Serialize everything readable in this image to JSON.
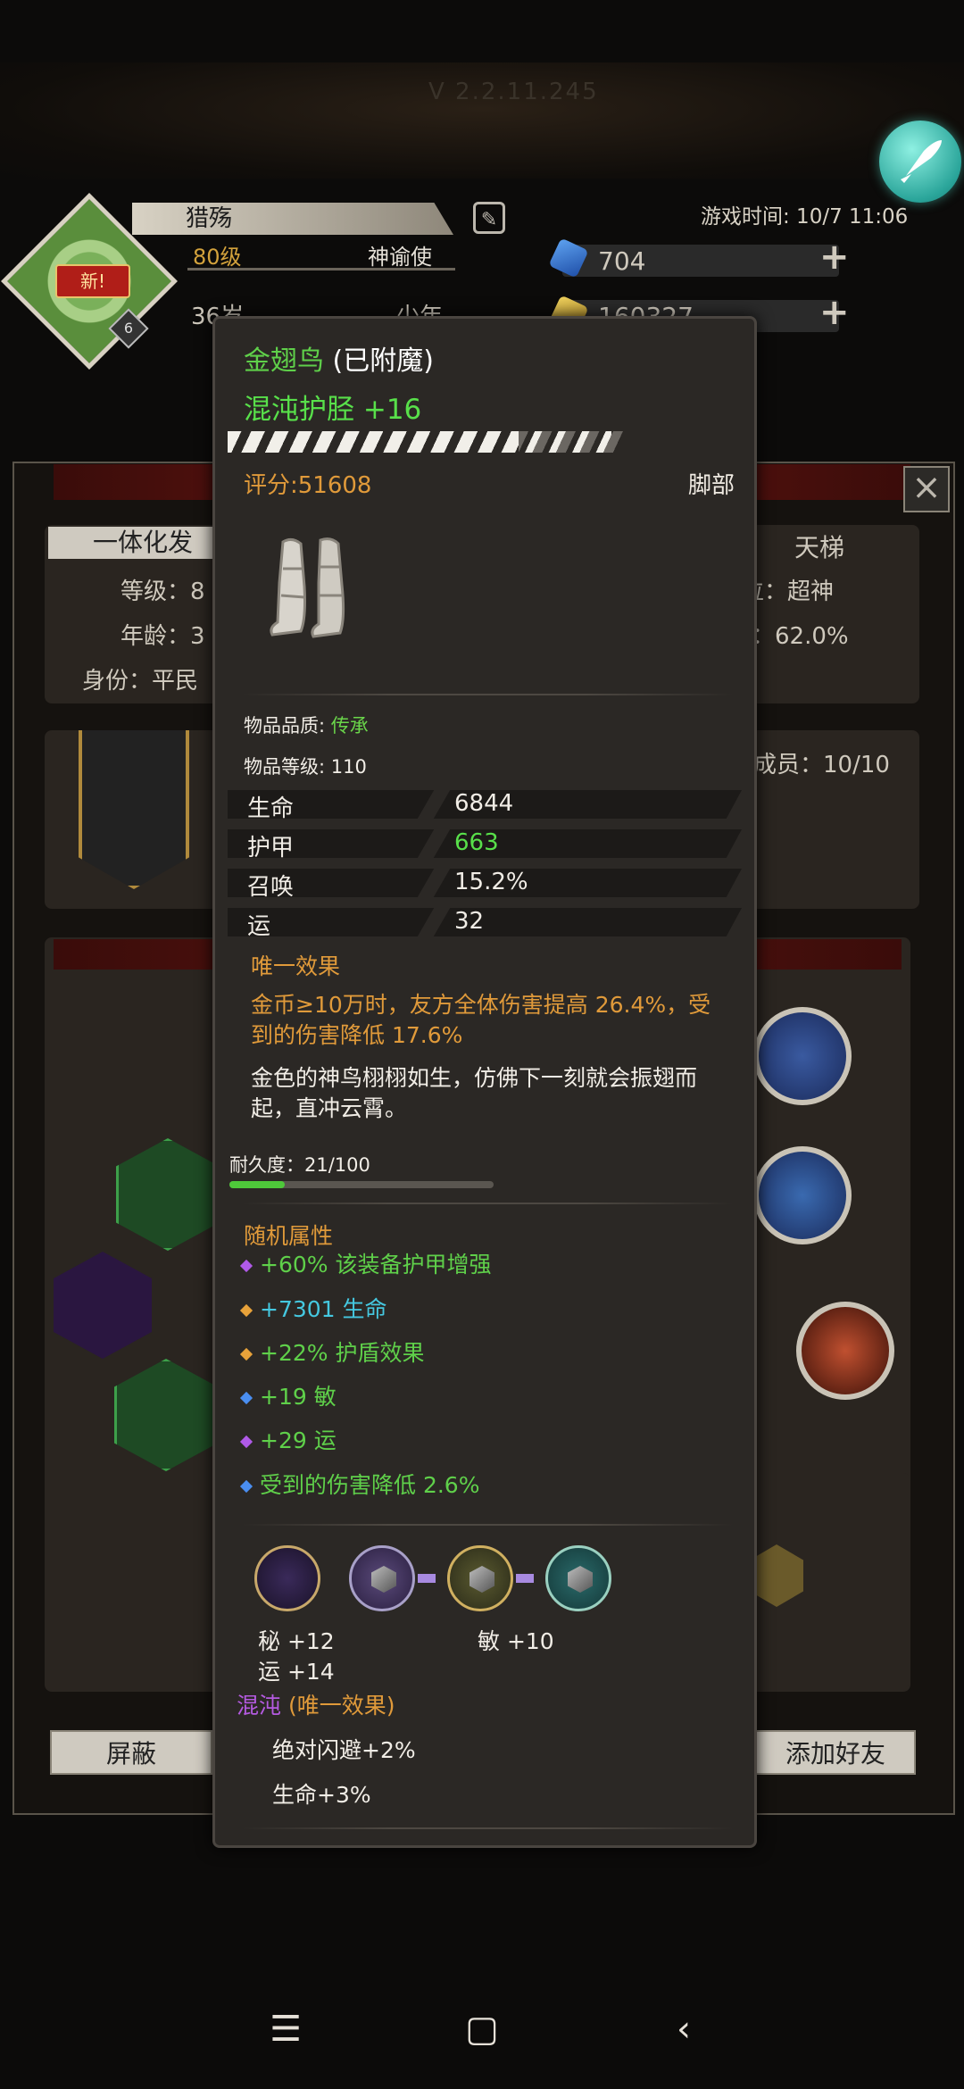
{
  "header": {
    "top_title": "V 2.2.11.245",
    "game_time": "游戏时间: 10/7 11:06",
    "new_badge": "新!",
    "avatar_level": "6",
    "player_name": "猎殇",
    "player_level": "80级",
    "player_role": "神谕使",
    "player_age": "36岁",
    "player_stage": "少年",
    "resources": [
      {
        "icon": "blue-crystal-icon",
        "value": "704"
      },
      {
        "icon": "gold-crystal-icon",
        "value": "160327"
      }
    ]
  },
  "background": {
    "tab_left": "一体化发",
    "tab_right": "天梯",
    "rows": [
      {
        "label": "等级：8",
        "right": "位：超神"
      },
      {
        "label": "年龄：3",
        "right": "：62.0%"
      },
      {
        "label": "身份：平民"
      }
    ],
    "members": "成员：10/10",
    "btn_block": "屏蔽",
    "btn_add_friend": "添加好友"
  },
  "tooltip": {
    "enchant_name": "金翅鸟",
    "enchant_suffix": "(已附魔)",
    "item_name": "混沌护胫 +16",
    "score": "评分:51608",
    "slot": "脚部",
    "quality_label": "物品品质: ",
    "quality_value": "传承",
    "item_level": "物品等级: 110",
    "stats": [
      {
        "name": "生命",
        "value": "6844",
        "highlight": false
      },
      {
        "name": "护甲",
        "value": "663",
        "highlight": true
      },
      {
        "name": "召唤",
        "value": "15.2%",
        "highlight": false
      },
      {
        "name": "运",
        "value": "32",
        "highlight": false
      }
    ],
    "unique_title": "唯一效果",
    "unique_text": "金币≥10万时，友方全体伤害提高 26.4%，受到的伤害降低 17.6%",
    "flavor_text": "金色的神鸟栩栩如生，仿佛下一刻就会振翅而起，直冲云霄。",
    "durability_label": "耐久度：21/100",
    "durability_current": 21,
    "durability_max": 100,
    "random_title": "随机属性",
    "random_attrs": [
      {
        "text": "+60% 该装备护甲增强",
        "dot": "#b05ae8",
        "color": "green"
      },
      {
        "text": "+7301 生命",
        "dot": "#e8a23a",
        "color": "blue"
      },
      {
        "text": "+22% 护盾效果",
        "dot": "#e8a23a",
        "color": "green"
      },
      {
        "text": "+19 敏",
        "dot": "#4a8ef0",
        "color": "green"
      },
      {
        "text": "+29 运",
        "dot": "#b05ae8",
        "color": "green"
      },
      {
        "text": "受到的伤害降低 2.6%",
        "dot": "#4a8ef0",
        "color": "green"
      }
    ],
    "socket_stats": [
      "秘 +12",
      "运 +14",
      "敏 +10"
    ],
    "chaos_title": "混沌",
    "chaos_suffix": "(唯一效果)",
    "chaos_lines": [
      "绝对闪避+2%",
      "生命+3%"
    ]
  },
  "colors": {
    "green": "#5fd04a",
    "orange": "#e09a3a",
    "purple": "#b45ae0",
    "cyan": "#45c8e0"
  },
  "icons": {
    "rocket": "rocket-icon",
    "edit": "edit-icon",
    "close": "close-icon",
    "boots": "boots-icon"
  }
}
